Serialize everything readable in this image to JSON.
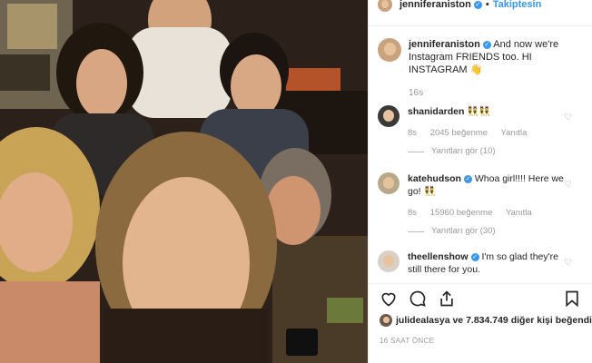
{
  "header": {
    "username": "jenniferaniston",
    "follow_label": "Takiptesin"
  },
  "caption": {
    "username": "jenniferaniston",
    "text": "And now we're Instagram FRIENDS too. HI INSTAGRAM 👋",
    "time": "16s"
  },
  "comments": [
    {
      "username": "shanidarden",
      "text": "👯👯",
      "time": "8s",
      "likes": "2045 beğenme",
      "reply_label": "Yanıtla",
      "replies": "Yanıtları gör (10)"
    },
    {
      "username": "katehudson",
      "text": "Whoa girl!!!! Here we go! 👯",
      "time": "8s",
      "likes": "15960 beğenme",
      "reply_label": "Yanıtla",
      "replies": "Yanıtları gör (30)"
    },
    {
      "username": "theellenshow",
      "text": "I'm so glad they're still there for you."
    }
  ],
  "actions": {
    "like_icon": "heart-icon",
    "comment_icon": "comment-icon",
    "share_icon": "share-icon",
    "save_icon": "bookmark-icon"
  },
  "likes": {
    "username": "julidealasya",
    "text": "ve 7.834.749 diğer kişi beğendi"
  },
  "post_time": "16 SAAT ÖNCE",
  "colors": {
    "accent": "#3897f0",
    "text": "#262626",
    "meta": "#999999"
  }
}
